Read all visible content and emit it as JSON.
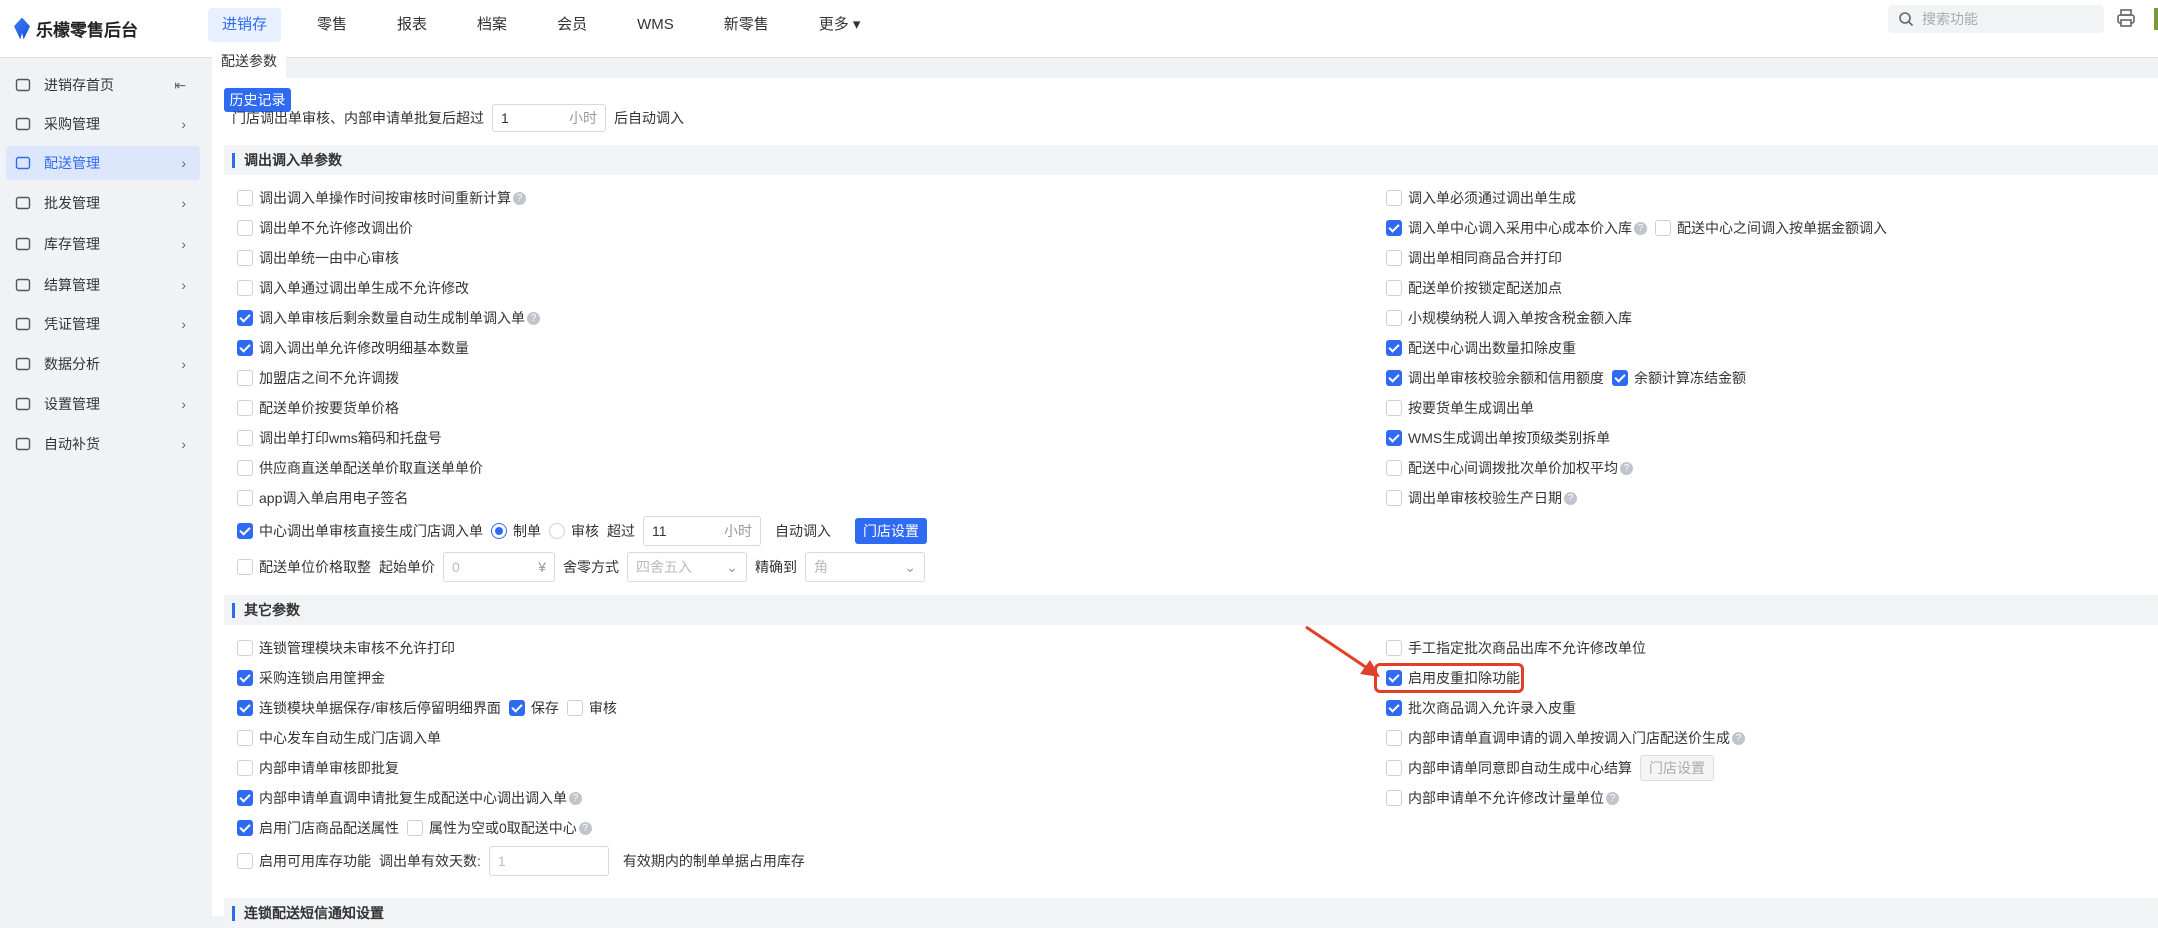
{
  "app": {
    "title": "乐檬零售后台"
  },
  "nav": [
    "进销存",
    "零售",
    "报表",
    "档案",
    "会员",
    "WMS",
    "新零售",
    "更多"
  ],
  "search": {
    "placeholder": "搜索功能"
  },
  "sidebar": [
    {
      "label": "进销存首页",
      "icon": "home-icon"
    },
    {
      "label": "采购管理",
      "icon": "cart-icon"
    },
    {
      "label": "配送管理",
      "icon": "delivery-icon",
      "active": true
    },
    {
      "label": "批发管理",
      "icon": "wholesale-icon"
    },
    {
      "label": "库存管理",
      "icon": "inventory-icon"
    },
    {
      "label": "结算管理",
      "icon": "settlement-icon"
    },
    {
      "label": "凭证管理",
      "icon": "voucher-icon"
    },
    {
      "label": "数据分析",
      "icon": "chart-icon"
    },
    {
      "label": "设置管理",
      "icon": "settings-icon"
    },
    {
      "label": "自动补货",
      "icon": "replenish-icon"
    }
  ],
  "tab": "配送参数",
  "history_button": "历史记录",
  "auto_line": {
    "prefix": "门店调出单审核、内部申请单批复后超过",
    "value": "1",
    "unit": "小时",
    "suffix": "后自动调入"
  },
  "sections": [
    {
      "title": "调出调入单参数",
      "left": [
        {
          "label": "调出调入单操作时间按审核时间重新计算",
          "checked": false,
          "help": true
        },
        {
          "label": "调出单不允许修改调出价",
          "checked": false
        },
        {
          "label": "调出单统一由中心审核",
          "checked": false
        },
        {
          "label": "调入单通过调出单生成不允许修改",
          "checked": false
        },
        {
          "label": "调入单审核后剩余数量自动生成制单调入单",
          "checked": true,
          "help": true
        },
        {
          "label": "调入调出单允许修改明细基本数量",
          "checked": true
        },
        {
          "label": "加盟店之间不允许调拨",
          "checked": false
        },
        {
          "label": "配送单价按要货单价格",
          "checked": false
        },
        {
          "label": "调出单打印wms箱码和托盘号",
          "checked": false
        },
        {
          "label": "供应商直送单配送单价取直送单单价",
          "checked": false
        },
        {
          "label": "app调入单启用电子签名",
          "checked": false
        },
        {
          "label": "中心调出单审核直接生成门店调入单",
          "checked": true,
          "tall": true,
          "extras": [
            {
              "type": "radio",
              "label": "制单",
              "checked": true
            },
            {
              "type": "radio",
              "label": "审核",
              "checked": false
            },
            {
              "type": "text",
              "label": "超过"
            },
            {
              "type": "input",
              "value": "11",
              "suffix": "小时",
              "w": 118
            },
            {
              "type": "text",
              "label": "自动调入",
              "gap": 14
            },
            {
              "type": "button",
              "label": "门店设置",
              "gap": 24
            }
          ]
        },
        {
          "label": "配送单位价格取整",
          "checked": false,
          "tall": true,
          "extras": [
            {
              "type": "text",
              "label": "起始单价"
            },
            {
              "type": "input",
              "value": "0",
              "suffix": "¥",
              "w": 112,
              "ph": true
            },
            {
              "type": "text",
              "label": "舍零方式"
            },
            {
              "type": "select",
              "value": "四舍五入",
              "w": 120
            },
            {
              "type": "text",
              "label": "精确到"
            },
            {
              "type": "select",
              "value": "角",
              "w": 120
            }
          ]
        }
      ],
      "right": [
        {
          "label": "调入单必须通过调出单生成",
          "checked": false
        },
        {
          "label": "调入单中心调入采用中心成本价入库",
          "checked": true,
          "help": true,
          "extras": [
            {
              "type": "checkbox",
              "label": "配送中心之间调入按单据金额调入",
              "checked": false
            }
          ]
        },
        {
          "label": "调出单相同商品合并打印",
          "checked": false
        },
        {
          "label": "配送单价按锁定配送加点",
          "checked": false
        },
        {
          "label": "小规模纳税人调入单按含税金额入库",
          "checked": false
        },
        {
          "label": "配送中心调出数量扣除皮重",
          "checked": true
        },
        {
          "label": "调出单审核校验余额和信用额度",
          "checked": true,
          "extras": [
            {
              "type": "checkbox",
              "label": "余额计算冻结金额",
              "checked": true
            }
          ]
        },
        {
          "label": "按要货单生成调出单",
          "checked": false
        },
        {
          "label": "WMS生成调出单按顶级类别拆单",
          "checked": true
        },
        {
          "label": "配送中心间调拨批次单价加权平均",
          "checked": false,
          "help": true
        },
        {
          "label": "调出单审核校验生产日期",
          "checked": false,
          "help": true
        }
      ]
    },
    {
      "title": "其它参数",
      "left": [
        {
          "label": "连锁管理模块未审核不允许打印",
          "checked": false
        },
        {
          "label": "采购连锁启用筐押金",
          "checked": true
        },
        {
          "label": "连锁模块单据保存/审核后停留明细界面",
          "checked": true,
          "extras": [
            {
              "type": "checkbox",
              "label": "保存",
              "checked": true
            },
            {
              "type": "checkbox",
              "label": "审核",
              "checked": false
            }
          ]
        },
        {
          "label": "中心发车自动生成门店调入单",
          "checked": false
        },
        {
          "label": "内部申请单审核即批复",
          "checked": false
        },
        {
          "label": "内部申请单直调申请批复生成配送中心调出调入单",
          "checked": true,
          "help": true
        },
        {
          "label": "启用门店商品配送属性",
          "checked": true,
          "extras": [
            {
              "type": "checkbox",
              "label": "属性为空或0取配送中心",
              "checked": false,
              "help": true
            }
          ]
        },
        {
          "label": "启用可用库存功能",
          "checked": false,
          "tall": true,
          "extras": [
            {
              "type": "text",
              "label": "调出单有效天数:"
            },
            {
              "type": "input",
              "value": "1",
              "suffix": "",
              "w": 120,
              "ph": true
            },
            {
              "type": "text",
              "label": "有效期内的制单单据占用库存",
              "gap": 14
            }
          ]
        }
      ],
      "right": [
        {
          "label": "手工指定批次商品出库不允许修改单位",
          "checked": false
        },
        {
          "label": "启用皮重扣除功能",
          "checked": true
        },
        {
          "label": "批次商品调入允许录入皮重",
          "checked": true
        },
        {
          "label": "内部申请单直调申请的调入单按调入门店配送价生成",
          "checked": false,
          "help": true
        },
        {
          "label": "内部申请单同意即自动生成中心结算",
          "checked": false,
          "extras": [
            {
              "type": "button",
              "label": "门店设置",
              "disabled": true
            }
          ]
        },
        {
          "label": "内部申请单不允许修改计量单位",
          "checked": false,
          "help": true
        }
      ]
    },
    {
      "title": "连锁配送短信通知设置",
      "left": [],
      "right": []
    }
  ],
  "colors": {
    "accent": "#2f6bf2",
    "highlight": "#e0402a"
  }
}
